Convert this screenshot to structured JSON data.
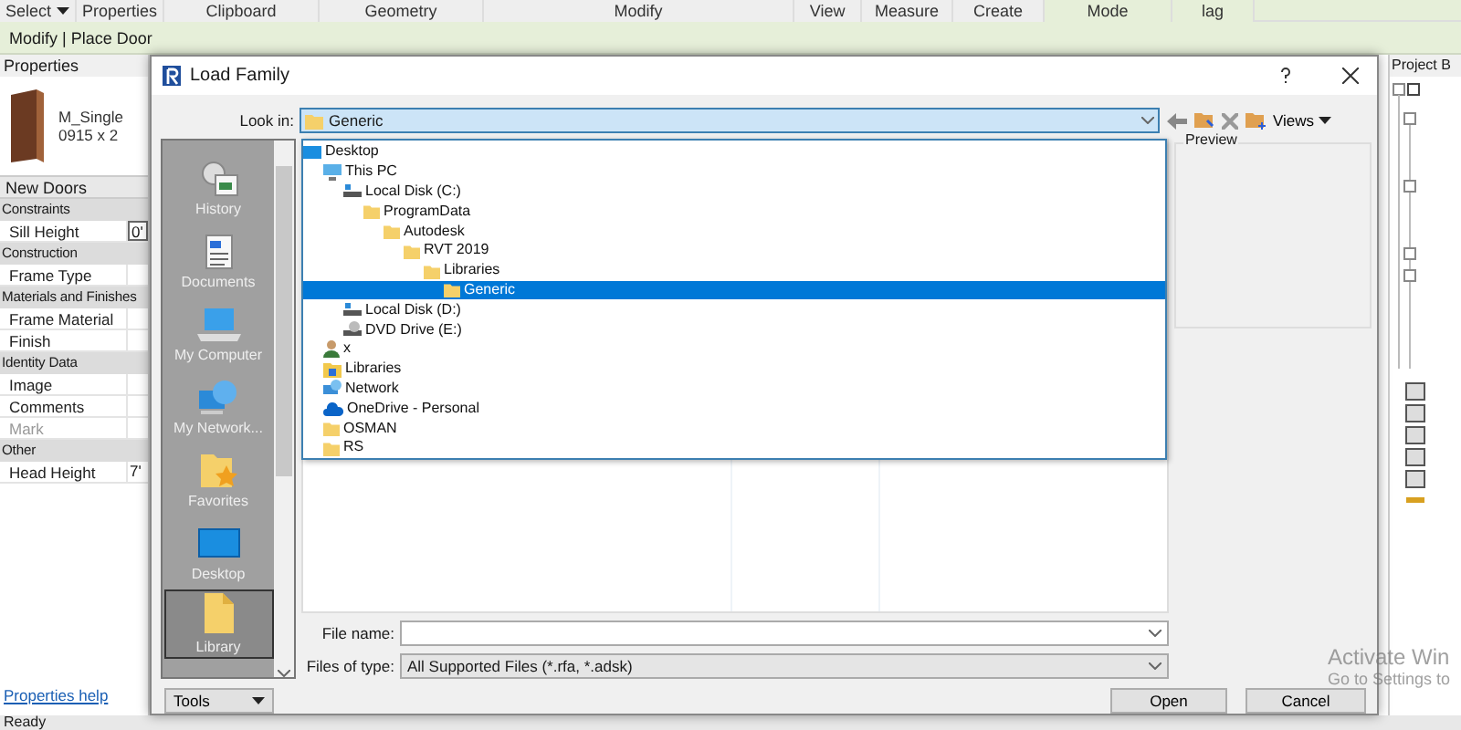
{
  "ribbon": {
    "panels": [
      {
        "label": "Select",
        "menu": true,
        "contextual": false
      },
      {
        "label": "Properties",
        "menu": false,
        "contextual": false
      },
      {
        "label": "Clipboard",
        "menu": false,
        "contextual": false
      },
      {
        "label": "Geometry",
        "menu": false,
        "contextual": false
      },
      {
        "label": "Modify",
        "menu": false,
        "contextual": false
      },
      {
        "label": "View",
        "menu": false,
        "contextual": false
      },
      {
        "label": "Measure",
        "menu": false,
        "contextual": false
      },
      {
        "label": "Create",
        "menu": false,
        "contextual": false
      },
      {
        "label": "Mode",
        "menu": false,
        "contextual": true
      },
      {
        "label": "lag",
        "menu": false,
        "contextual": true
      }
    ]
  },
  "context_bar": "Modify | Place Door",
  "properties": {
    "title": "Properties",
    "type_name": "M_Single",
    "type_size": "0915 x 2",
    "type_selector": "New Doors",
    "groups": [
      {
        "name": "Constraints",
        "rows": [
          {
            "label": "Sill Height",
            "value": "0'",
            "disabled": false
          }
        ]
      },
      {
        "name": "Construction",
        "rows": [
          {
            "label": "Frame Type",
            "disabled": false
          }
        ]
      },
      {
        "name": "Materials and Finishes",
        "rows": [
          {
            "label": "Frame Material",
            "disabled": false
          },
          {
            "label": "Finish",
            "disabled": false
          }
        ]
      },
      {
        "name": "Identity Data",
        "rows": [
          {
            "label": "Image",
            "disabled": false
          },
          {
            "label": "Comments",
            "disabled": false
          },
          {
            "label": "Mark",
            "disabled": true
          }
        ]
      },
      {
        "name": "Other",
        "rows": [
          {
            "label": "Head Height",
            "value": "7'",
            "disabled": false
          }
        ]
      }
    ],
    "help_link": "Properties help"
  },
  "project_browser": {
    "title": "Project B"
  },
  "status_bar": "Ready",
  "dialog": {
    "title": "Load Family",
    "look_in": {
      "label": "Look in:",
      "value": "Generic"
    },
    "toolbar": {
      "views": "Views"
    },
    "places": [
      {
        "label": "History",
        "kind": "history",
        "selected": false
      },
      {
        "label": "Documents",
        "kind": "documents",
        "selected": false
      },
      {
        "label": "My Computer",
        "kind": "computer",
        "selected": false
      },
      {
        "label": "My Network...",
        "kind": "network",
        "selected": false
      },
      {
        "label": "Favorites",
        "kind": "favorites",
        "selected": false
      },
      {
        "label": "Desktop",
        "kind": "desktop",
        "selected": false
      },
      {
        "label": "Library",
        "kind": "folder",
        "selected": true
      }
    ],
    "tree": [
      {
        "label": "Desktop",
        "kind": "desktop",
        "selected": false,
        "children": [
          {
            "label": "This PC",
            "kind": "computer",
            "selected": false,
            "children": [
              {
                "label": "Local Disk (C:)",
                "kind": "drive",
                "selected": false,
                "children": [
                  {
                    "label": "ProgramData",
                    "kind": "folder",
                    "selected": false,
                    "children": [
                      {
                        "label": "Autodesk",
                        "kind": "folder",
                        "selected": false,
                        "children": [
                          {
                            "label": "RVT 2019",
                            "kind": "folder",
                            "selected": false,
                            "children": [
                              {
                                "label": "Libraries",
                                "kind": "folder",
                                "selected": false,
                                "children": [
                                  {
                                    "label": "Generic",
                                    "kind": "folder",
                                    "selected": true
                                  }
                                ]
                              }
                            ]
                          }
                        ]
                      }
                    ]
                  }
                ]
              },
              {
                "label": "Local Disk (D:)",
                "kind": "drive",
                "selected": false
              },
              {
                "label": "DVD Drive (E:)",
                "kind": "dvd",
                "selected": false
              }
            ]
          },
          {
            "label": "x",
            "kind": "user",
            "selected": false
          },
          {
            "label": "Libraries",
            "kind": "libraries",
            "selected": false
          },
          {
            "label": "Network",
            "kind": "network",
            "selected": false
          },
          {
            "label": "OneDrive - Personal",
            "kind": "cloud",
            "selected": false
          },
          {
            "label": "OSMAN",
            "kind": "folder",
            "selected": false
          },
          {
            "label": "RS",
            "kind": "folder",
            "selected": false
          }
        ]
      }
    ],
    "preview": "Preview",
    "file_name": {
      "label": "File name:"
    },
    "file_type": {
      "label": "Files of type:",
      "value": "All Supported Files  (*.rfa, *.adsk)"
    },
    "buttons": {
      "tools": "Tools",
      "open": "Open",
      "cancel": "Cancel"
    }
  },
  "os_notice": {
    "line1": "Activate Win",
    "line2": "Go to Settings to"
  }
}
